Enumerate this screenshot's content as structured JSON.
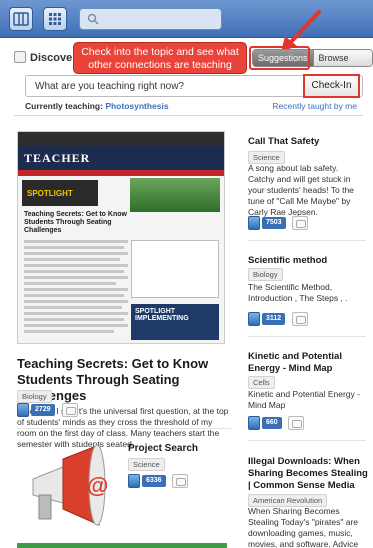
{
  "topbar": {
    "grid_button_icon": "columns-icon",
    "apps_button_icon": "apps-grid-icon",
    "search_icon": "search-icon",
    "search_placeholder": ""
  },
  "discover": {
    "label": "Discover"
  },
  "callout": {
    "text": "Check into the topic and see what other connections are teaching"
  },
  "segments": {
    "suggestions": "Suggestions",
    "browse": "Browse Topics"
  },
  "teach": {
    "placeholder": "What are you teaching right now?",
    "checkin_label": "Check-In"
  },
  "current": {
    "prefix": "Currently teaching:",
    "topic": "Photosynthesis",
    "recent_link": "Recently taught by me"
  },
  "thumbnail": {
    "masthead": "TEACHER",
    "ad_text": "SPOTLIGHT",
    "headline": "Teaching Secrets: Get to Know Students Through Seating Challenges",
    "promo": "SPOTLIGHT IMPLEMENTING"
  },
  "main_article": {
    "title": "Teaching Secrets: Get to Know Students Through Seating Challenges",
    "tag": "Biology",
    "description": "Where do I sit? It's the universal first question, at the top of students' minds as they cross the threshold of my room on the first day of class. Many teachers start the semester with students seated",
    "checkins": "2729"
  },
  "project": {
    "title": "Project Search",
    "tag": "Science",
    "checkins": "6336"
  },
  "right_items": [
    {
      "title": "Call That Safety",
      "tag": "Science",
      "description": "A song about lab safety. Catchy and will get stuck in your students' heads! To the tune of \"Call Me Maybe\" by Carly Rae Jepsen.",
      "checkins": "7503"
    },
    {
      "title": "Scientific method",
      "tag": "Biology",
      "description": "The Scientific Method, Introduction , The Steps , .",
      "checkins": "3112"
    },
    {
      "title": "Kinetic and Potential Energy - Mind Map",
      "tag": "Cells",
      "description": "Kinetic and Potential Energy - Mind Map",
      "checkins": "660"
    },
    {
      "title": "Illegal Downloads: When Sharing Becomes Stealing | Common Sense Media",
      "tag": "American Revolution",
      "description": "When Sharing Becomes Stealing Today's \"pirates\" are downloading games, music, movies, and software. Advice & Answers"
    }
  ],
  "colors": {
    "topbar": "#4a78bb",
    "accent_red": "#e0362c",
    "link_blue": "#3b70b8"
  }
}
